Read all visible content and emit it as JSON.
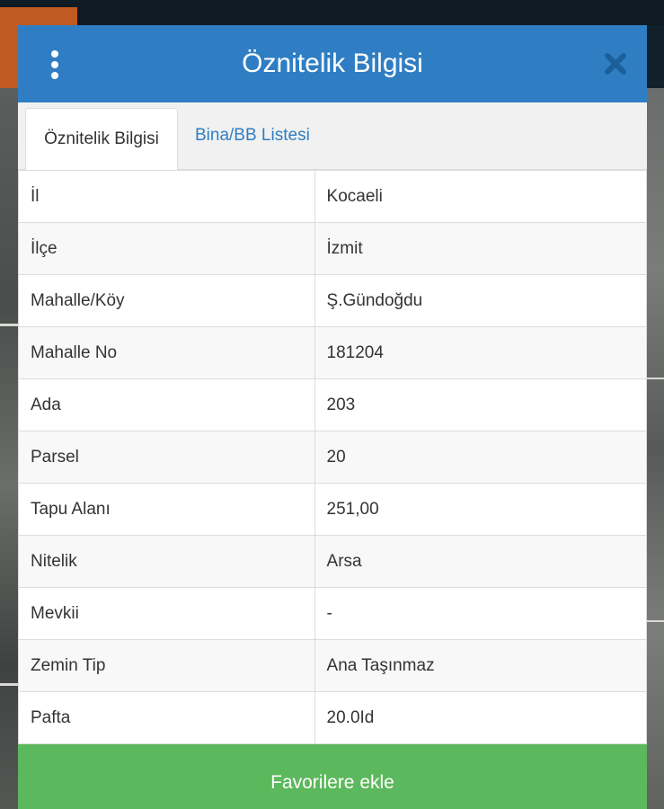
{
  "modal": {
    "title": "Öznitelik Bilgisi",
    "menu_icon": "vertical-ellipsis-icon",
    "close_icon": "close-icon"
  },
  "tabs": [
    {
      "label": "Öznitelik Bilgisi",
      "active": true
    },
    {
      "label": "Bina/BB Listesi",
      "active": false
    }
  ],
  "attributes": [
    {
      "key": "İl",
      "value": "Kocaeli"
    },
    {
      "key": "İlçe",
      "value": "İzmit"
    },
    {
      "key": "Mahalle/Köy",
      "value": "Ş.Gündoğdu"
    },
    {
      "key": "Mahalle No",
      "value": "181204"
    },
    {
      "key": "Ada",
      "value": "203"
    },
    {
      "key": "Parsel",
      "value": "20"
    },
    {
      "key": "Tapu Alanı",
      "value": "251,00"
    },
    {
      "key": "Nitelik",
      "value": "Arsa"
    },
    {
      "key": "Mevkii",
      "value": "-"
    },
    {
      "key": "Zemin Tip",
      "value": "Ana Taşınmaz"
    },
    {
      "key": "Pafta",
      "value": "20.0Id"
    }
  ],
  "footer": {
    "favorite_label": "Favorilere ekle"
  },
  "colors": {
    "header": "#2f7ec3",
    "tab_link": "#2f7ec3",
    "favorite_button": "#5cb85c"
  }
}
